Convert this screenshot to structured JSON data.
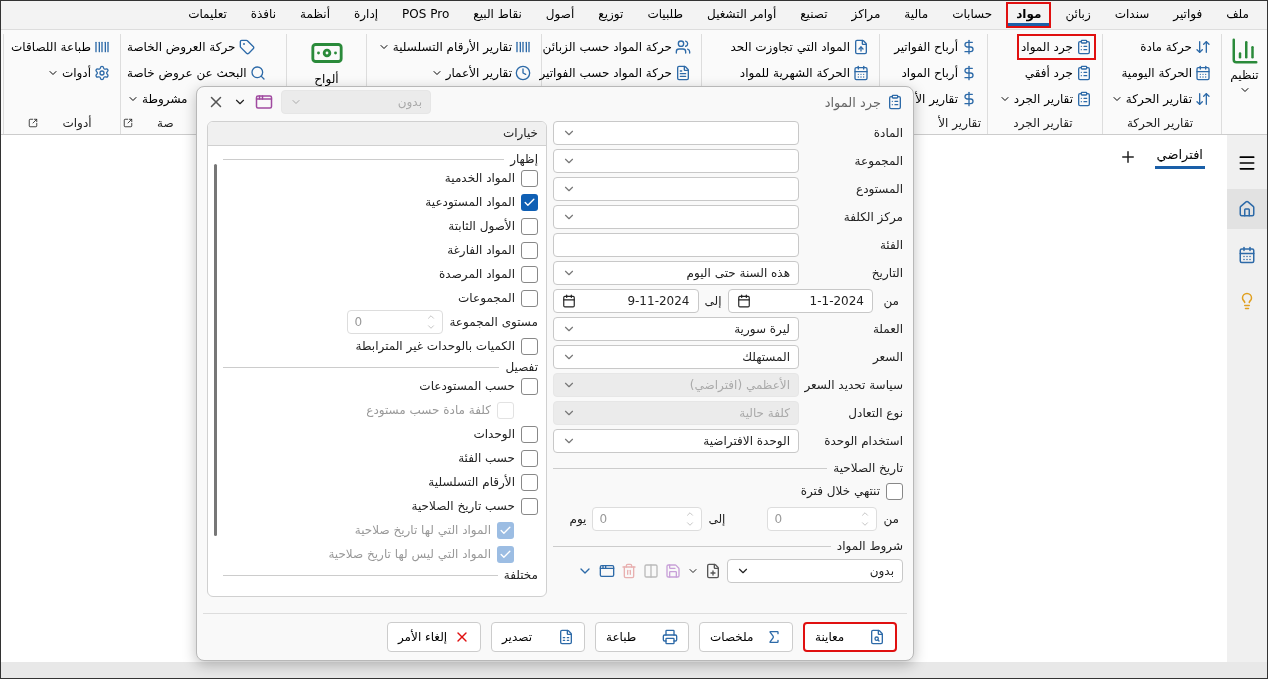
{
  "menu": [
    {
      "label": "ملف",
      "selected": false,
      "highlighted": false
    },
    {
      "label": "فواتير",
      "selected": false,
      "highlighted": false
    },
    {
      "label": "سندات",
      "selected": false,
      "highlighted": false
    },
    {
      "label": "زبائن",
      "selected": false,
      "highlighted": false
    },
    {
      "label": "مواد",
      "selected": true,
      "highlighted": true
    },
    {
      "label": "حسابات",
      "selected": false,
      "highlighted": false
    },
    {
      "label": "مالية",
      "selected": false,
      "highlighted": false
    },
    {
      "label": "مراكز",
      "selected": false,
      "highlighted": false
    },
    {
      "label": "تصنيع",
      "selected": false,
      "highlighted": false
    },
    {
      "label": "أوامر التشغيل",
      "selected": false,
      "highlighted": false
    },
    {
      "label": "طلبيات",
      "selected": false,
      "highlighted": false
    },
    {
      "label": "توزيع",
      "selected": false,
      "highlighted": false
    },
    {
      "label": "أصول",
      "selected": false,
      "highlighted": false
    },
    {
      "label": "نقاط البيع",
      "selected": false,
      "highlighted": false
    },
    {
      "label": "POS Pro",
      "selected": false,
      "highlighted": false
    },
    {
      "label": "إدارة",
      "selected": false,
      "highlighted": false
    },
    {
      "label": "أنظمة",
      "selected": false,
      "highlighted": false
    },
    {
      "label": "نافذة",
      "selected": false,
      "highlighted": false
    },
    {
      "label": "تعليمات",
      "selected": false,
      "highlighted": false
    }
  ],
  "ribbon": [
    {
      "kind": "large",
      "label": "تنظيم",
      "dropdown": true
    },
    {
      "kind": "list",
      "title": "تقارير الحركة",
      "items": [
        {
          "label": "حركة مادة",
          "dropdown": false,
          "highlighted": false
        },
        {
          "label": "الحركة اليومية",
          "dropdown": false,
          "highlighted": false
        },
        {
          "label": "تقارير الحركة",
          "dropdown": true,
          "highlighted": false
        }
      ]
    },
    {
      "kind": "list",
      "title": "تقارير الجرد",
      "items": [
        {
          "label": "جرد المواد",
          "dropdown": false,
          "highlighted": true
        },
        {
          "label": "جرد أفقي",
          "dropdown": false,
          "highlighted": false
        },
        {
          "label": "تقارير الجرد",
          "dropdown": true,
          "highlighted": false
        }
      ]
    },
    {
      "kind": "list",
      "title": "تقارير الأ",
      "items": [
        {
          "label": "أرباح الفواتير",
          "dropdown": false,
          "highlighted": false
        },
        {
          "label": "أرباح المواد",
          "dropdown": false,
          "highlighted": false
        },
        {
          "label": "تقارير الأ",
          "dropdown": false,
          "highlighted": false
        }
      ]
    },
    {
      "kind": "list",
      "items": [
        {
          "label": "المواد التي تجاوزت الحد",
          "dropdown": false,
          "highlighted": false
        },
        {
          "label": "الحركة الشهرية للمواد",
          "dropdown": false,
          "highlighted": false
        }
      ]
    },
    {
      "kind": "list",
      "items": [
        {
          "label": "حركة المواد حسب الزبائن",
          "dropdown": false,
          "highlighted": false
        },
        {
          "label": "حركة المواد حسب الفواتير",
          "dropdown": false,
          "highlighted": false
        }
      ]
    },
    {
      "kind": "list",
      "items": [
        {
          "label": "تقارير الأرقام التسلسلية",
          "dropdown": true,
          "highlighted": false
        },
        {
          "label": "تقارير الأعمار",
          "dropdown": true,
          "highlighted": false
        }
      ]
    },
    {
      "kind": "large",
      "label": "ألواح"
    },
    {
      "kind": "list",
      "title": "صة",
      "launcher": true,
      "items": [
        {
          "label": "حركة العروض الخاصة",
          "dropdown": false,
          "highlighted": false
        },
        {
          "label": "البحث عن عروض خاصة",
          "dropdown": false,
          "highlighted": false
        },
        {
          "label": "مشروطة",
          "dropdown": true,
          "highlighted": false
        }
      ]
    },
    {
      "kind": "list",
      "title": "أدوات",
      "launcher": true,
      "items": [
        {
          "label": "طباعة اللصاقات",
          "dropdown": false,
          "highlighted": false
        },
        {
          "label": "أدوات",
          "dropdown": true,
          "highlighted": false
        }
      ]
    }
  ],
  "sidebar_items": [
    {
      "selected": true
    },
    {
      "selected": false
    },
    {
      "selected": false
    }
  ],
  "tabs": [
    {
      "label": "افتراضي",
      "selected": true
    }
  ],
  "dialog": {
    "title": "جرد المواد",
    "template_select": {
      "value": "بدون",
      "disabled": true
    },
    "fields": [
      {
        "kind": "combo",
        "label": "المادة",
        "disabled": false
      },
      {
        "kind": "combo",
        "label": "المجموعة",
        "disabled": false
      },
      {
        "kind": "combo",
        "label": "المستودع",
        "disabled": false
      },
      {
        "kind": "combo",
        "label": "مركز الكلفة",
        "disabled": false
      },
      {
        "kind": "text",
        "label": "الفئة",
        "disabled": false
      },
      {
        "kind": "combo",
        "label": "التاريخ",
        "value": "هذه السنة حتى اليوم",
        "disabled": false
      },
      {
        "kind": "daterange",
        "label": "من",
        "from": "1-1-2024",
        "to_label": "إلى",
        "to": "9-11-2024"
      },
      {
        "kind": "combo",
        "label": "العملة",
        "value": "ليرة سورية",
        "disabled": false
      },
      {
        "kind": "combo",
        "label": "السعر",
        "value": "المستهلك",
        "disabled": false
      },
      {
        "kind": "combo",
        "label": "سياسة تحديد السعر",
        "value": "الأعظمي (افتراضي)",
        "disabled": true
      },
      {
        "kind": "combo",
        "label": "نوع التعادل",
        "value": "كلفة حالية",
        "disabled": true
      },
      {
        "kind": "combo",
        "label": "استخدام الوحدة",
        "value": "الوحدة الافتراضية",
        "disabled": false
      }
    ],
    "expiry": {
      "title": "تاريخ الصلاحية",
      "checkbox": {
        "label": "تنتهي خلال فترة",
        "checked": false
      },
      "from_label": "من",
      "from": "0",
      "to_label": "إلى",
      "to": "0",
      "unit": "يوم",
      "disabled": true
    },
    "conditions": {
      "title": "شروط المواد",
      "value": "بدون"
    },
    "options": {
      "title": "خيارات",
      "sections": [
        {
          "title": "إظهار",
          "items": [
            {
              "kind": "checkbox",
              "label": "المواد الخدمية",
              "checked": false,
              "disabled": false
            },
            {
              "kind": "checkbox",
              "label": "المواد المستودعية",
              "checked": true,
              "disabled": false
            },
            {
              "kind": "checkbox",
              "label": "الأصول الثابتة",
              "checked": false,
              "disabled": false
            },
            {
              "kind": "checkbox",
              "label": "المواد الفارغة",
              "checked": false,
              "disabled": false
            },
            {
              "kind": "checkbox",
              "label": "المواد المرصدة",
              "checked": false,
              "disabled": false
            },
            {
              "kind": "checkbox",
              "label": "المجموعات",
              "checked": false,
              "disabled": false
            },
            {
              "kind": "spin",
              "label": "مستوى المجموعة",
              "value": "0",
              "disabled": true
            },
            {
              "kind": "checkbox",
              "label": "الكميات بالوحدات غير المترابطة",
              "checked": false,
              "disabled": false
            }
          ]
        },
        {
          "title": "تفصيل",
          "items": [
            {
              "kind": "checkbox",
              "label": "حسب المستودعات",
              "checked": false,
              "disabled": false,
              "children": [
                {
                  "kind": "checkbox",
                  "label": "كلفة مادة حسب مستودع",
                  "checked": false,
                  "disabled": true
                }
              ]
            },
            {
              "kind": "checkbox",
              "label": "الوحدات",
              "checked": false,
              "disabled": false
            },
            {
              "kind": "checkbox",
              "label": "حسب الفئة",
              "checked": false,
              "disabled": false
            },
            {
              "kind": "checkbox",
              "label": "الأرقام التسلسلية",
              "checked": false,
              "disabled": false
            },
            {
              "kind": "checkbox",
              "label": "حسب تاريخ الصلاحية",
              "checked": false,
              "disabled": false,
              "children": [
                {
                  "kind": "checkbox",
                  "label": "المواد التي لها تاريخ صلاحية",
                  "checked": true,
                  "disabled": true
                },
                {
                  "kind": "checkbox",
                  "label": "المواد التي ليس لها تاريخ صلاحية",
                  "checked": true,
                  "disabled": true
                }
              ]
            }
          ]
        },
        {
          "title": "مختلفة"
        }
      ]
    },
    "buttons": [
      {
        "label": "معاينة",
        "highlighted": true
      },
      {
        "label": "ملخصات",
        "highlighted": false
      },
      {
        "label": "طباعة",
        "highlighted": false
      },
      {
        "label": "تصدير",
        "highlighted": false
      },
      {
        "label": "إلغاء الأمر",
        "highlighted": false
      }
    ]
  }
}
